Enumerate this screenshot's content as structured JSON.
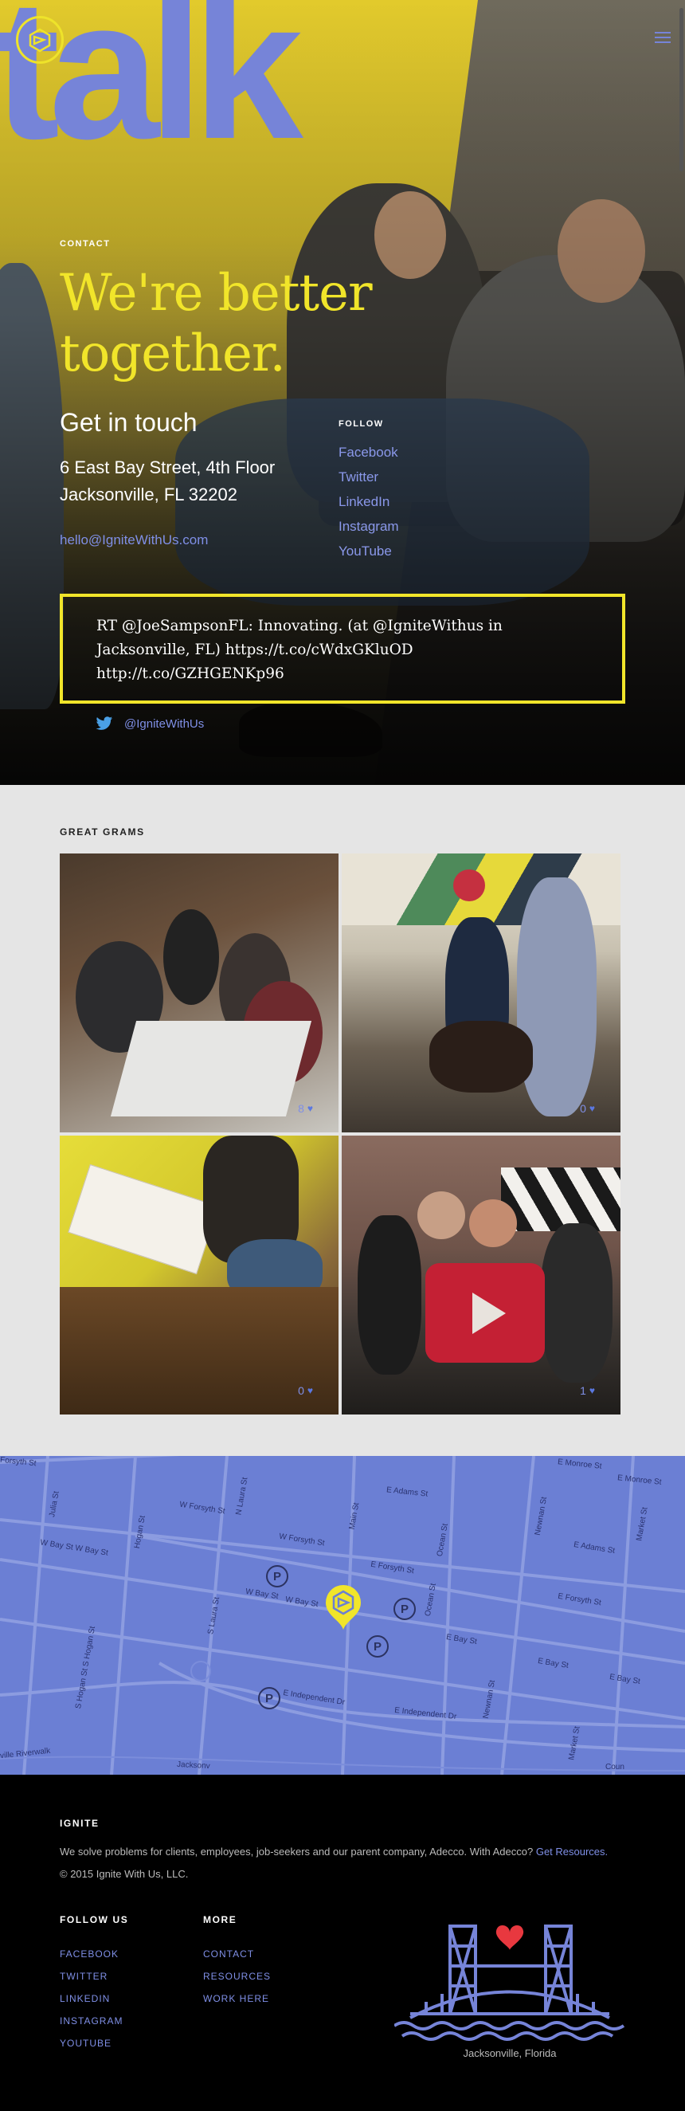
{
  "hero": {
    "brand_word": "talk",
    "section_label": "CONTACT",
    "headline": "We're better together.",
    "get_in_touch": "Get in touch",
    "address_line1": "6 East Bay Street, 4th Floor",
    "address_line2": "Jacksonville, FL 32202",
    "email": "hello@IgniteWithUs.com",
    "follow_label": "FOLLOW",
    "follow_links": [
      "Facebook",
      "Twitter",
      "LinkedIn",
      "Instagram",
      "YouTube"
    ],
    "tweet_text": "RT @JoeSampsonFL: Innovating. (at @IgniteWithus in Jacksonville, FL) https://t.co/cWdxGKluOD http://t.co/GZHGENKp96",
    "tweet_handle": "@IgniteWithUs",
    "accent_yellow": "#f1e52a",
    "accent_blue": "#7684d8"
  },
  "grams": {
    "title": "GREAT GRAMS",
    "photos": [
      {
        "likes": "8",
        "icon": "heart-icon"
      },
      {
        "likes": "0",
        "icon": "heart-icon"
      },
      {
        "likes": "0",
        "icon": "heart-icon"
      },
      {
        "likes": "1",
        "icon": "heart-icon"
      }
    ]
  },
  "map": {
    "labels": [
      "Forsyth St",
      "E Monroe St",
      "E Monroe St",
      "Julia St",
      "E Adams St",
      "W Forsyth St",
      "N Laura St",
      "Hogan St",
      "W Bay St W Bay St",
      "W Forsyth St",
      "Main St",
      "Ocean St",
      "Newnan St",
      "E Adams St",
      "Market St",
      "E Forsyth St",
      "W Bay St",
      "W Bay St",
      "S Laura St",
      "Ocean St",
      "E Bay St",
      "E Forsyth St",
      "E Bay St",
      "E Bay St",
      "S Hogan St S Hogan St",
      "E Independent Dr",
      "E Independent Dr",
      "Newnan St",
      "Market St",
      "ville Riverwalk",
      "Jacksonv",
      "Coun"
    ],
    "parking_symbol": "P"
  },
  "footer": {
    "company": "IGNITE",
    "description": "We solve problems for clients, employees, job-seekers and our parent company, Adecco. With Adecco? ",
    "description_link": "Get Resources.",
    "copyright": "© 2015 Ignite With Us, LLC.",
    "follow_title": "FOLLOW US",
    "follow_links": [
      "FACEBOOK",
      "TWITTER",
      "LINKEDIN",
      "INSTAGRAM",
      "YOUTUBE"
    ],
    "more_title": "MORE",
    "more_links": [
      "CONTACT",
      "RESOURCES",
      "WORK HERE"
    ],
    "bridge_caption": "Jacksonville, Florida"
  }
}
